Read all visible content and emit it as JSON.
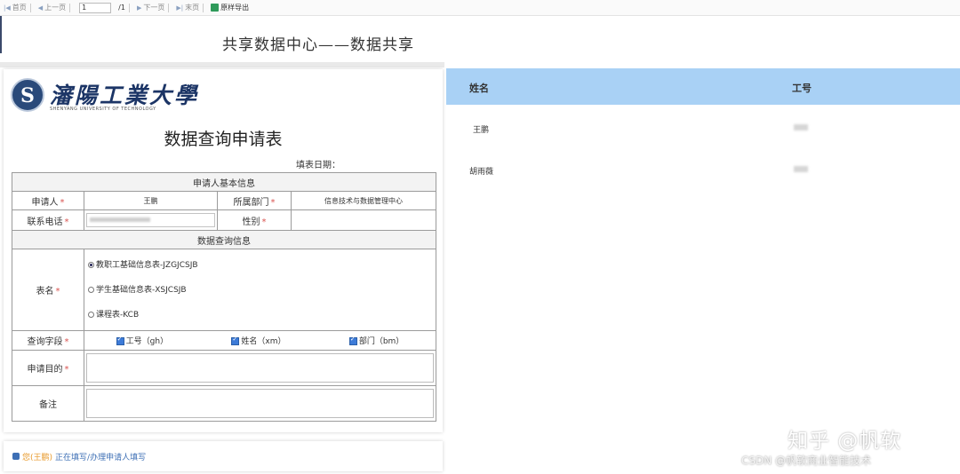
{
  "toolbar": {
    "first_page": "首页",
    "prev_page": "上一页",
    "page_number": "1",
    "page_total": "/1",
    "next_page": "下一页",
    "last_page": "末页",
    "export": "原样导出"
  },
  "page_title": "共享数据中心——数据共享",
  "form": {
    "logo_text": "瀋陽工業大學",
    "logo_subtitle": "SHENYANG UNIVERSITY OF TECHNOLOGY",
    "title": "数据查询申请表",
    "fill_date_label": "填表日期：",
    "section_basic": "申请人基本信息",
    "applicant_label": "申请人",
    "applicant_value": "王鹏",
    "department_label": "所属部门",
    "department_value": "信息技术与数据管理中心",
    "phone_label": "联系电话",
    "gender_label": "性别",
    "section_query": "数据查询信息",
    "table_name_label": "表名",
    "table_options": [
      "教职工基础信息表-JZGJCSJB",
      "学生基础信息表-XSJCSJB",
      "课程表-KCB"
    ],
    "query_field_label": "查询字段",
    "query_fields": [
      "工号（gh）",
      "姓名（xm）",
      "部门（bm）"
    ],
    "purpose_label": "申请目的",
    "remark_label": "备注",
    "required_mark": "*"
  },
  "status": {
    "user": "您(王鹏)",
    "message": "正在填写/办理申请人填写"
  },
  "grid": {
    "columns": [
      "姓名",
      "工号"
    ],
    "rows": [
      {
        "name": "王鹏"
      },
      {
        "name": "胡雨薇"
      }
    ]
  },
  "watermark": {
    "line1": "知乎 @帆软",
    "line2": "CSDN @帆软商业智能技术"
  },
  "colors": {
    "grid_header": "#a9d1f5",
    "required": "#d9534f",
    "status_text": "#3d6fb5"
  }
}
